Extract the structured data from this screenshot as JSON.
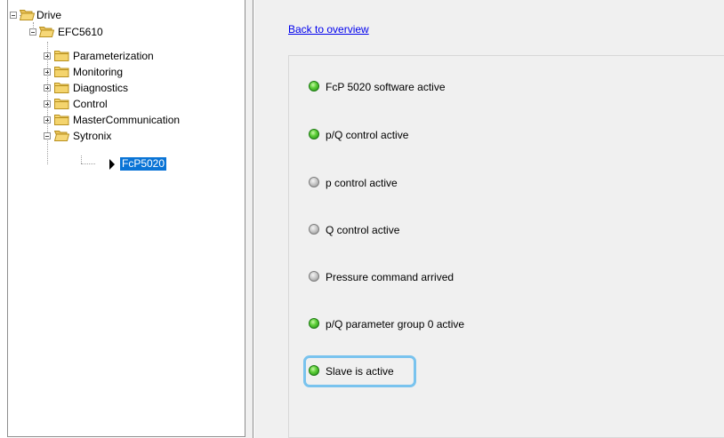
{
  "tree": {
    "nodes": [
      {
        "label": "Drive",
        "icon": "folder-open-icon",
        "expander": "minus"
      },
      {
        "label": "EFC5610",
        "icon": "folder-open-icon",
        "expander": "minus"
      },
      {
        "label": "Parameterization",
        "icon": "folder-icon",
        "expander": "plus"
      },
      {
        "label": "Monitoring",
        "icon": "folder-icon",
        "expander": "plus"
      },
      {
        "label": "Diagnostics",
        "icon": "folder-icon",
        "expander": "plus"
      },
      {
        "label": "Control",
        "icon": "folder-icon",
        "expander": "plus"
      },
      {
        "label": "MasterCommunication",
        "icon": "folder-icon",
        "expander": "plus"
      },
      {
        "label": "Sytronix",
        "icon": "folder-open-icon",
        "expander": "minus"
      },
      {
        "label": "FcP5020",
        "icon": "arrow-right-icon",
        "selected": true
      }
    ]
  },
  "content": {
    "back_link": "Back to overview",
    "status_items": [
      {
        "label": "FcP 5020 software active",
        "state": "on"
      },
      {
        "label": "p/Q control active",
        "state": "on"
      },
      {
        "label": "p control active",
        "state": "off"
      },
      {
        "label": "Q control active",
        "state": "off"
      },
      {
        "label": "Pressure command arrived",
        "state": "off"
      },
      {
        "label": "p/Q parameter group 0 active",
        "state": "on"
      },
      {
        "label": "Slave is active",
        "state": "on",
        "focused": true
      }
    ]
  },
  "colors": {
    "led_on": "#3cc026",
    "led_off": "#b0b0b0",
    "selection": "#0a74d6",
    "focus_ring": "#79c3ee",
    "link": "#0000ee"
  }
}
